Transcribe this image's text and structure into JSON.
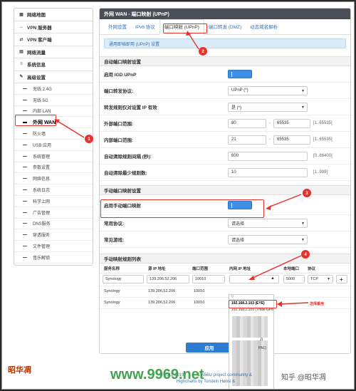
{
  "sidebar": {
    "items": [
      {
        "label": "网络地图",
        "icon": "network-map-icon",
        "glyph": "▦"
      },
      {
        "label": "VPN 服务器",
        "icon": "vpn-server-icon",
        "glyph": "↔"
      },
      {
        "label": "VPN 客户端",
        "icon": "vpn-client-icon",
        "glyph": "⇄"
      },
      {
        "label": "网络流量",
        "icon": "traffic-icon",
        "glyph": "▤"
      },
      {
        "label": "系统信息",
        "icon": "info-icon",
        "glyph": "≡"
      },
      {
        "label": "高级设置",
        "icon": "wrench-icon",
        "glyph": "✎"
      }
    ],
    "subitems": [
      "无线 2.4G",
      "无线 5G",
      "内部 LAN",
      "外网 WAN",
      "防火墙",
      "USB 应用",
      "系统管理",
      "参数设置",
      "网络信息",
      "系统日志",
      "科学上网",
      "广告管理",
      "DNS服务",
      "穿透服务",
      "文件管理",
      "音乐解锁"
    ],
    "active_index": 3
  },
  "header": {
    "title": "外网 WAN - 端口映射 (UPnP)"
  },
  "tabs": [
    "外网设置",
    "IPv6 协议",
    "端口映射 (UPnP)",
    "端口转发 (DMZ)",
    "动态域名解析"
  ],
  "active_tab": 2,
  "info_text": "通用即插即用 (UPnP) 设置",
  "auto_section": {
    "title": "自动端口映射设置",
    "enable_upnp_label": "启用 IGD UPnP",
    "protocol_label": "端口转发协议:",
    "protocol_value": "UPnP (*)",
    "only_ip_label": "转发规则仅对设置 IP 有效",
    "only_ip_value": "是 (*)",
    "ext_range_label": "外部端口范围:",
    "ext_from": "80",
    "ext_to": "65535",
    "ext_hint": "[1..65535]",
    "int_range_label": "内部端口范围:",
    "int_from": "21",
    "int_to": "65535",
    "int_hint": "[1..65535]",
    "clean_interval_label": "自动清除规则间隔 (秒):",
    "clean_interval_value": "600",
    "clean_interval_hint": "[0..86400]",
    "clean_min_label": "自动清除最少规则数:",
    "clean_min_value": "10",
    "clean_min_hint": "[1..999]",
    "range_sep": "-"
  },
  "manual_section": {
    "title": "手动端口映射设置",
    "enable_label": "启用手动端口映射",
    "common_label": "常用协议:",
    "common_value": "请选择",
    "game_label": "常见游戏:",
    "game_value": "请选择"
  },
  "list_section": {
    "title": "手动映射规则列表",
    "headers": [
      "服务名称",
      "源 IP 地址",
      "端口范围",
      "内网 IP 地址",
      "本地端口",
      "协议"
    ],
    "input_row": {
      "service": "Synology",
      "src_ip": "139.206.52.206",
      "port": "10010",
      "local_port": "5000",
      "protocol": "TCP"
    },
    "rows": [
      {
        "service": "Synology",
        "src_ip": "139.206.52.206",
        "port": "10010"
      },
      {
        "service": "Synology",
        "src_ip": "139.206.52.206",
        "port": "10010"
      }
    ]
  },
  "dropdown": {
    "items": [
      "192.168.2.103 (EYE)",
      "192.168.2.109 (Tmall-Genie)"
    ],
    "highlight_index": 0,
    "partial_labels": [
      "9",
      "J)",
      "PA1)"
    ]
  },
  "apply_label": "应用",
  "footer": {
    "line1_prefix": "© 2011-2019",
    "line1_suffix": "& N56U project community & ",
    "line2": "Highcharts by Torstein Hønsi & "
  },
  "annotations": {
    "callouts": [
      "1",
      "2",
      "3",
      "4"
    ],
    "select_text": "选择着用",
    "color": "#e5322d"
  },
  "watermark": {
    "site": "www.9969.net",
    "credit": "知乎 @昭华凋"
  },
  "logo_text": "昭华凋"
}
